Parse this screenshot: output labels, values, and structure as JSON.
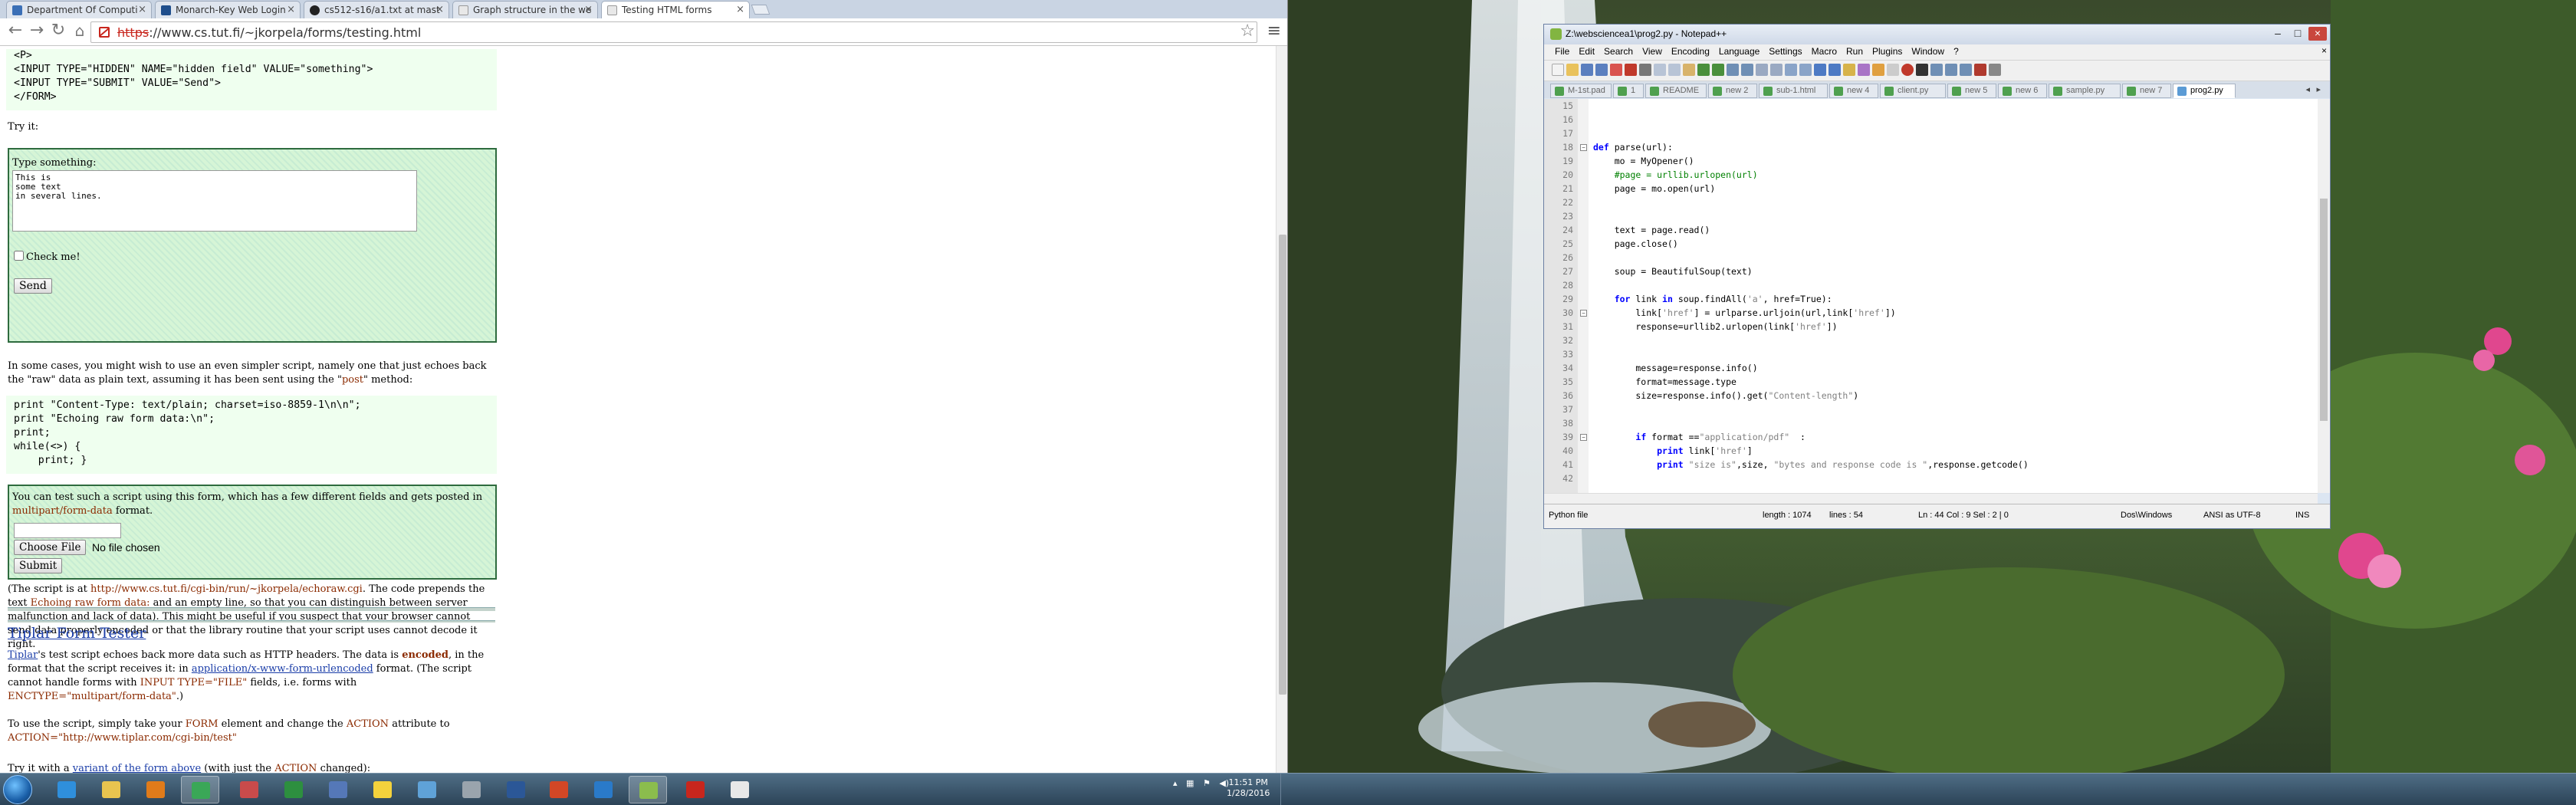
{
  "chrome": {
    "tabs": [
      {
        "label": "Department Of Computi",
        "icon_color": "#3b6fb6",
        "active": false
      },
      {
        "label": "Monarch-Key Web Login",
        "icon_color": "#1f4e8c",
        "active": false
      },
      {
        "label": "cs512-s16/a1.txt at mast",
        "icon_color": "#222222",
        "active": false
      },
      {
        "label": "Graph structure in the we",
        "icon_color": "#e8e8e8",
        "active": false
      },
      {
        "label": "Testing HTML forms",
        "icon_color": "#e8e8e8",
        "active": true
      }
    ],
    "url_proto": "https",
    "url_rest": "://www.cs.tut.fi/~jkorpela/forms/testing.html",
    "nav_icons": [
      "back-arrow-icon",
      "forward-arrow-icon",
      "reload-icon",
      "home-icon"
    ]
  },
  "page": {
    "top_code": "<P>\n<INPUT TYPE=\"HIDDEN\" NAME=\"hidden field\" VALUE=\"something\">\n<INPUT TYPE=\"SUBMIT\" VALUE=\"Send\">\n</FORM>",
    "try_it": "Try it:",
    "form1": {
      "label": "Type something:",
      "textarea": "This is\nsome text\nin several lines.",
      "checkbox_label": "Check me!",
      "send": "Send"
    },
    "p1": "In some cases, you might wish to use an even simpler script, namely one that just echoes back the \"raw\" data as plain text, assuming it has been sent using the \"",
    "p1_post": "post",
    "p1_end": "\" method:",
    "code2": "print \"Content-Type: text/plain; charset=iso-8859-1\\n\\n\";\nprint \"Echoing raw form data:\\n\";\nprint;\nwhile(<>) {\n    print; }",
    "form2": {
      "text_a": "You can test such a script using this form, which has a few different fields and gets posted in ",
      "text_hl": "multipart/form-data",
      "text_b": " format.",
      "choose_file": "Choose File",
      "no_file": "No file chosen",
      "submit": "Submit"
    },
    "p2_a": "(The script is at ",
    "p2_url": "http://www.cs.tut.fi/cgi-bin/run/~jkorpela/echoraw.cgi",
    "p2_b": ". The code prepends the text ",
    "p2_hl": "Echoing raw form data:",
    "p2_c": " and an empty line, so that you can distinguish between server malfunction and lack of data). This might be useful if you suspect that your browser cannot send data properly encoded or that the library routine that your script uses cannot decode it right.",
    "heading": "Tiplar Form Tester",
    "p3_link": "Tiplar",
    "p3_a": "'s test script echoes back more data such as HTTP headers. The data is ",
    "p3_bold": "encoded",
    "p3_b": ", in the format that the script receives it: in ",
    "p3_link2": "application/x-www-form-urlencoded",
    "p3_c": " format. (The script cannot handle forms with ",
    "p3_hl": "INPUT TYPE=\"FILE\"",
    "p3_d": " fields, i.e. forms with ",
    "p3_hl2": "ENCTYPE=\"multipart/form-data\"",
    "p3_e": ".)",
    "p4_a": "To use the script, simply take your ",
    "p4_form": "FORM",
    "p4_b": " element and change the ",
    "p4_action": "ACTION",
    "p4_c": " attribute to",
    "p4_val": "ACTION=\"http://www.tiplar.com/cgi-bin/test\"",
    "p5_a": "Try it with a ",
    "p5_link": "variant of the form above",
    "p5_b": " (with just the ",
    "p5_action": "ACTION",
    "p5_c": " changed):"
  },
  "npp": {
    "title": "Z:\\websciencea1\\prog2.py - Notepad++",
    "menu": [
      "File",
      "Edit",
      "Search",
      "View",
      "Encoding",
      "Language",
      "Settings",
      "Macro",
      "Run",
      "Plugins",
      "Window",
      "?"
    ],
    "tabs": [
      {
        "label": "M-1st.pad",
        "active": false
      },
      {
        "label": "1",
        "active": false
      },
      {
        "label": "README",
        "active": false
      },
      {
        "label": "new 2",
        "active": false
      },
      {
        "label": "sub-1.html",
        "active": false
      },
      {
        "label": "new 4",
        "active": false
      },
      {
        "label": "client.py",
        "active": false
      },
      {
        "label": "new 5",
        "active": false
      },
      {
        "label": "new 6",
        "active": false
      },
      {
        "label": "sample.py",
        "active": false
      },
      {
        "label": "new 7",
        "active": false
      },
      {
        "label": "prog2.py",
        "active": true
      }
    ],
    "line_numbers": [
      "15",
      "16",
      "17",
      "18",
      "19",
      "20",
      "21",
      "22",
      "23",
      "24",
      "25",
      "26",
      "27",
      "28",
      "29",
      "30",
      "31",
      "32",
      "33",
      "34",
      "35",
      "36",
      "37",
      "38",
      "39",
      "40",
      "41",
      "42"
    ],
    "code_lines": [
      "",
      "",
      "",
      "def parse(url):",
      "    mo = MyOpener()",
      "    #page = urllib.urlopen(url)",
      "    page = mo.open(url)",
      "",
      "",
      "    text = page.read()",
      "    page.close()",
      "",
      "    soup = BeautifulSoup(text)",
      "",
      "    for link in soup.findAll('a', href=True):",
      "        link['href'] = urlparse.urljoin(url,link['href'])",
      "        response=urllib2.urlopen(link['href'])",
      "",
      "",
      "        message=response.info()",
      "        format=message.type",
      "        size=response.info().get(\"Content-length\")",
      "",
      "",
      "        if format ==\"application/pdf\"  :",
      "            print link['href']",
      "            print \"size is\",size, \"bytes and response code is \",response.getcode()",
      ""
    ],
    "status": {
      "lang": "Python file",
      "length": "length : 1074",
      "lines": "lines : 54",
      "pos": "Ln : 44    Col : 9    Sel : 2 | 0",
      "eol": "Dos\\Windows",
      "enc": "ANSI as UTF-8",
      "ins": "INS"
    }
  },
  "taskbar": {
    "apps": [
      {
        "name": "internet-explorer-icon",
        "color": "#2f8fdc"
      },
      {
        "name": "file-explorer-icon",
        "color": "#e8c44f"
      },
      {
        "name": "media-player-icon",
        "color": "#e07b1a"
      },
      {
        "name": "chrome-icon",
        "color": "#3aa757"
      },
      {
        "name": "paint-icon",
        "color": "#c94b4b"
      },
      {
        "name": "excel-icon",
        "color": "#2d8f3f"
      },
      {
        "name": "network-icon",
        "color": "#5578b8"
      },
      {
        "name": "sticky-notes-icon",
        "color": "#f4d23c"
      },
      {
        "name": "photos-icon",
        "color": "#5fa2d8"
      },
      {
        "name": "settings-icon",
        "color": "#9aa4ad"
      },
      {
        "name": "word-icon",
        "color": "#2b5797"
      },
      {
        "name": "powerpoint-icon",
        "color": "#d24726"
      },
      {
        "name": "lync-icon",
        "color": "#2a7ac9"
      },
      {
        "name": "notepad-icon",
        "color": "#8bbd4d"
      },
      {
        "name": "acrobat-icon",
        "color": "#c8261d"
      },
      {
        "name": "tex-icon",
        "color": "#e8e8e8"
      }
    ],
    "time": "11:51 PM",
    "date": "1/28/2016"
  }
}
